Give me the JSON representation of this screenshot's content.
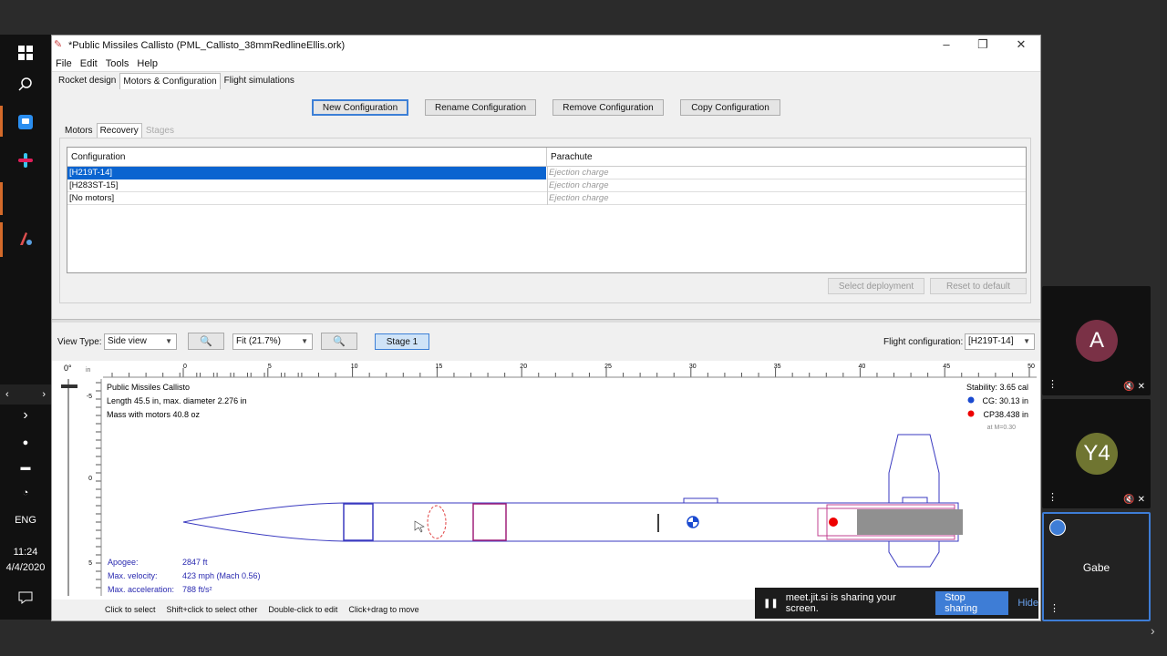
{
  "window": {
    "title": "*Public Missiles Callisto (PML_Callisto_38mmRedlineEllis.ork)",
    "menu": [
      "File",
      "Edit",
      "Tools",
      "Help"
    ],
    "tabs": [
      "Rocket design",
      "Motors & Configuration",
      "Flight simulations"
    ]
  },
  "config_buttons": {
    "new": "New Configuration",
    "rename": "Rename Configuration",
    "remove": "Remove Configuration",
    "copy": "Copy Configuration"
  },
  "subtabs": [
    "Motors",
    "Recovery",
    "Stages"
  ],
  "recovery_table": {
    "headers": [
      "Configuration",
      "Parachute"
    ],
    "rows": [
      {
        "config": "[H219T-14]",
        "parachute": "Ejection charge"
      },
      {
        "config": "[H283ST-15]",
        "parachute": "Ejection charge"
      },
      {
        "config": "[No motors]",
        "parachute": "Ejection charge"
      }
    ],
    "buttons": {
      "select": "Select deployment",
      "reset": "Reset to default"
    }
  },
  "view_toolbar": {
    "view_type_label": "View Type:",
    "view_type_value": "Side view",
    "zoom_value": "Fit (21.7%)",
    "stage_button": "Stage 1",
    "flight_config_label": "Flight configuration:",
    "flight_config_value": "[H219T-14]"
  },
  "rocket": {
    "name": "Public Missiles Callisto",
    "length_line": "Length 45.5 in, max. diameter 2.276 in",
    "mass_line": "Mass with motors 40.8 oz",
    "stability": "Stability: 3.65 cal",
    "cg": "CG: 30.13 in",
    "cp": "CP38.438 in",
    "mach": "at M=0.30",
    "rotation": "0°",
    "ruler_unit": "in",
    "ruler_ticks": [
      "0",
      "5",
      "10",
      "15",
      "20",
      "25",
      "30",
      "35",
      "40",
      "45",
      "50"
    ],
    "vruler_ticks": [
      "-5",
      "0",
      "5"
    ],
    "apogee_label": "Apogee:",
    "apogee_value": "2847 ft",
    "velocity_label": "Max. velocity:",
    "velocity_value": "423 mph  (Mach 0.56)",
    "accel_label": "Max. acceleration:",
    "accel_value": "788 ft/s²"
  },
  "status_hints": [
    "Click to select",
    "Shift+click to select other",
    "Double-click to edit",
    "Click+drag to move"
  ],
  "taskbar": {
    "lang": "ENG",
    "time": "11:24",
    "date": "4/4/2020"
  },
  "video": {
    "tiles": [
      {
        "initial": "A",
        "color": "#7a3146"
      },
      {
        "initial": "Y4",
        "color": "#6f7531"
      }
    ],
    "local_name": "Gabe"
  },
  "share": {
    "message": "meet.jit.si is sharing your screen.",
    "stop": "Stop sharing",
    "hide": "Hide"
  }
}
